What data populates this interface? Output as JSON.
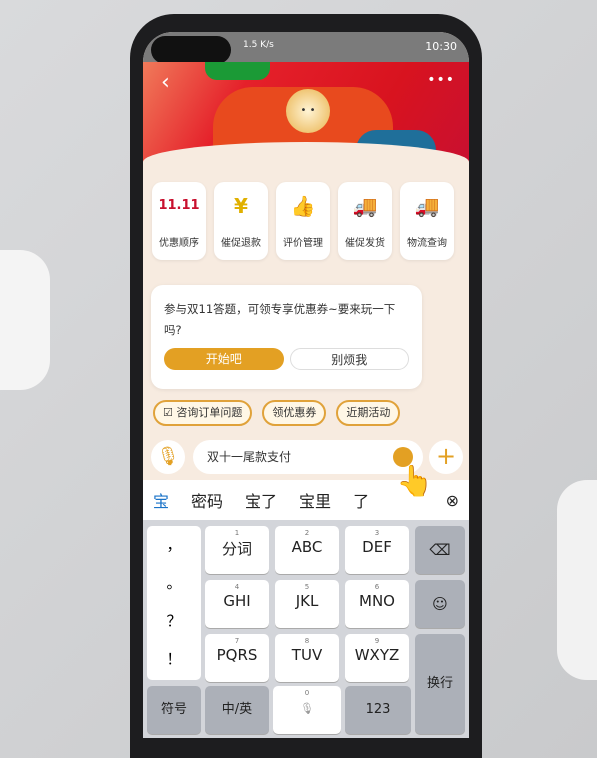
{
  "status": {
    "left": "1.5 K/s",
    "time": "10:30"
  },
  "nav": {
    "back_icon": "chevron-left-icon",
    "more": "•••"
  },
  "shortcuts": [
    {
      "label": "优惠顺序",
      "icon": "11.11",
      "color": "#c8102e"
    },
    {
      "label": "催促退款",
      "icon": "¥",
      "color": "#e0b000"
    },
    {
      "label": "评价管理",
      "icon": "👍",
      "color": "#e0b000"
    },
    {
      "label": "催促发货",
      "icon": "🚚",
      "color": "#1a73c8"
    },
    {
      "label": "物流查询",
      "icon": "🚚",
      "color": "#1a73c8"
    }
  ],
  "chat": {
    "message": "参与双11答题，可领专享优惠券~要来玩一下吗?",
    "primary": "开始吧",
    "secondary": "别烦我"
  },
  "chips": [
    "☑ 咨询订单问题",
    "领优惠券",
    "近期活动"
  ],
  "input": {
    "value": "双十一尾款支付"
  },
  "candidates": [
    "宝",
    "密码",
    "宝了",
    "宝里",
    "了"
  ],
  "keyboard": {
    "punct": [
      "，",
      "。",
      "？",
      "！"
    ],
    "keys": [
      [
        "1",
        "分词"
      ],
      [
        "2",
        "ABC"
      ],
      [
        "3",
        "DEF"
      ],
      [
        "4",
        "GHI"
      ],
      [
        "5",
        "JKL"
      ],
      [
        "6",
        "MNO"
      ],
      [
        "7",
        "PQRS"
      ],
      [
        "8",
        "TUV"
      ],
      [
        "9",
        "WXYZ"
      ]
    ],
    "symbol": "符号",
    "lang": "中/英",
    "space_num": "0",
    "num": "123",
    "enter": "换行",
    "backspace": "⌫",
    "emoji": "☺"
  },
  "colors": {
    "accent": "#e3a023",
    "banner": "#d8131f",
    "bg": "#f7ebe0"
  }
}
